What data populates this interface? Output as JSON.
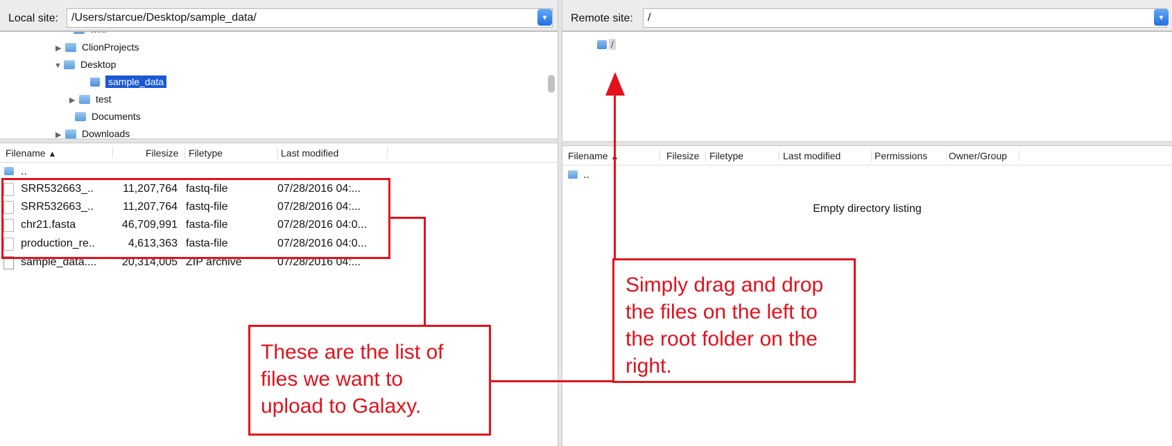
{
  "local": {
    "site_label": "Local site:",
    "path": "/Users/starcue/Desktop/sample_data/",
    "tree": {
      "partial_top": "wiki",
      "items": [
        {
          "label": "ClionProjects"
        },
        {
          "label": "Desktop"
        },
        {
          "label": "sample_data"
        },
        {
          "label": "test"
        },
        {
          "label": "Documents"
        },
        {
          "label": "Downloads"
        }
      ]
    },
    "columns": [
      "Filename",
      "Filesize",
      "Filetype",
      "Last modified"
    ],
    "parent_dir": "..",
    "files": [
      {
        "name": "SRR532663_..",
        "size": "11,207,764",
        "type": "fastq-file",
        "modified": "07/28/2016 04:..."
      },
      {
        "name": "SRR532663_..",
        "size": "11,207,764",
        "type": "fastq-file",
        "modified": "07/28/2016 04:..."
      },
      {
        "name": "chr21.fasta",
        "size": "46,709,991",
        "type": "fasta-file",
        "modified": "07/28/2016 04:0..."
      },
      {
        "name": "production_re..",
        "size": "4,613,363",
        "type": "fasta-file",
        "modified": "07/28/2016 04:0..."
      },
      {
        "name": "sample_data....",
        "size": "20,314,005",
        "type": "ZIP archive",
        "modified": "07/28/2016 04:..."
      }
    ]
  },
  "remote": {
    "site_label": "Remote site:",
    "path": "/",
    "tree_root": "/",
    "columns": [
      "Filename",
      "Filesize",
      "Filetype",
      "Last modified",
      "Permissions",
      "Owner/Group"
    ],
    "parent_dir": "..",
    "empty_message": "Empty directory listing"
  },
  "annotations": {
    "left_note": "These are the list of\nfiles we want to\nupload to Galaxy.",
    "right_note": "Simply drag and drop\nthe files on the left to\nthe root folder on the\nright."
  },
  "colors": {
    "annotation": "#e3111c",
    "selection": "#1b58d4"
  }
}
